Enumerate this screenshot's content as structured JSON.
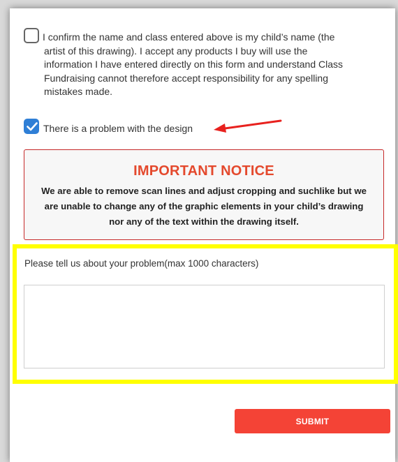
{
  "form": {
    "confirm_checkbox": {
      "checked": false
    },
    "confirm_lines": [
      "I confirm the name and class entered above is my child’s name (the",
      "artist of this drawing). I accept any products I buy will use the",
      "information I have entered directly on this form and understand Class",
      "Fundraising cannot therefore accept responsibility for any spelling",
      "mistakes made."
    ],
    "problem_checkbox": {
      "checked": true
    },
    "problem_label": "There is a problem with the design"
  },
  "notice": {
    "title": "IMPORTANT NOTICE",
    "lines": [
      "We are able to remove scan lines and adjust cropping and suchlike but we",
      "are unable to change any of the graphic elements in your child’s drawing",
      "nor any of the text within the drawing itself."
    ]
  },
  "problem_field": {
    "label": "Please tell us about your problem(max 1000 characters)",
    "value": "",
    "placeholder": ""
  },
  "submit_label": "SUBMIT",
  "colors": {
    "accent": "#f44336",
    "notice_title": "#e4492d",
    "notice_border": "#c62828",
    "checkbox_checked": "#2f7fd6",
    "highlight": "#ffff00",
    "arrow": "#e8211e"
  }
}
